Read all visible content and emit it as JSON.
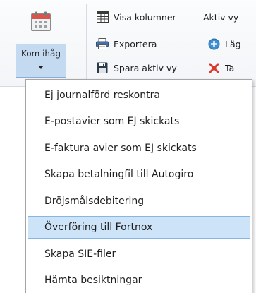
{
  "ribbon": {
    "kom_ihag_label": "Kom ihåg",
    "row1": {
      "visa_kolumner": "Visa kolumner",
      "aktiv_vy": "Aktiv vy"
    },
    "row2": {
      "exportera": "Exportera",
      "lagg": "Läg"
    },
    "row3": {
      "spara_aktiv_vy": "Spara aktiv vy",
      "ta": "Ta"
    }
  },
  "menu": {
    "items": [
      {
        "label": "Ej journalförd reskontra"
      },
      {
        "label": "E-postavier som EJ skickats"
      },
      {
        "label": "E-faktura avier som EJ skickats"
      },
      {
        "label": "Skapa betalningfil till Autogiro"
      },
      {
        "label": "Dröjsmålsdebitering"
      },
      {
        "label": "Överföring till Fortnox",
        "highlighted": true
      },
      {
        "label": "Skapa SIE-filer"
      },
      {
        "label": "Hämta besiktningar"
      }
    ]
  },
  "colors": {
    "highlight": "#cde3f8",
    "highlight_border": "#86b6e6",
    "delete_red": "#d83a2e",
    "calendar_red": "#d9534f"
  },
  "icons": {
    "big_button": "calendar-icon",
    "visa_kolumner": "columns-icon",
    "exportera": "printer-icon",
    "spara_aktiv_vy": "floppy-disk-icon",
    "lagg": "add-circle-icon",
    "ta": "delete-x-icon"
  }
}
